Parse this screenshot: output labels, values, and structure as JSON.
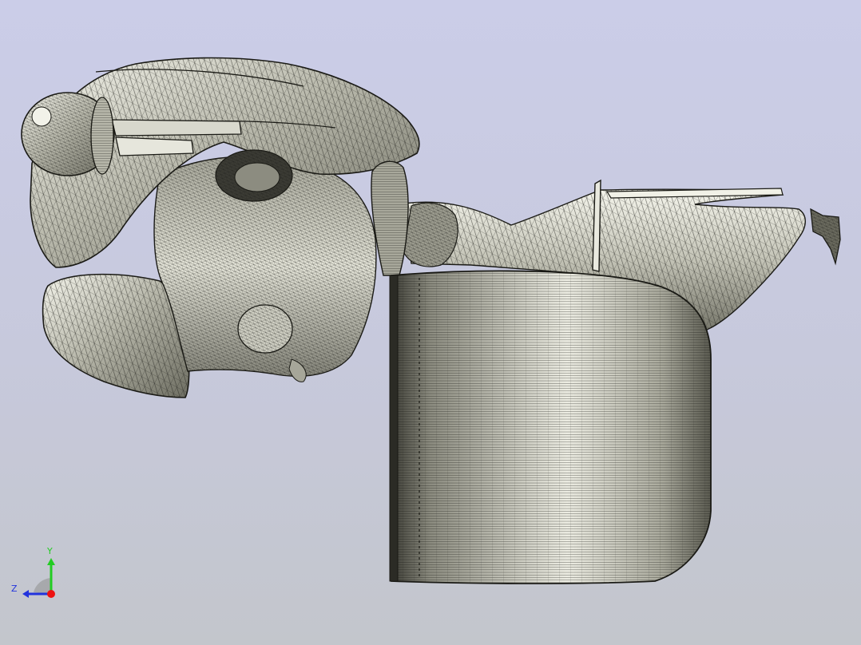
{
  "axis_triad": {
    "y_label": "Y",
    "z_label": "Z",
    "y_color": "#22cc22",
    "z_color": "#2233dd",
    "x_color": "#ee1111"
  },
  "viewport": {
    "background_top": "#cbcde8",
    "background_bottom": "#c3c6cc",
    "shading_mode": "shaded-with-edges"
  }
}
